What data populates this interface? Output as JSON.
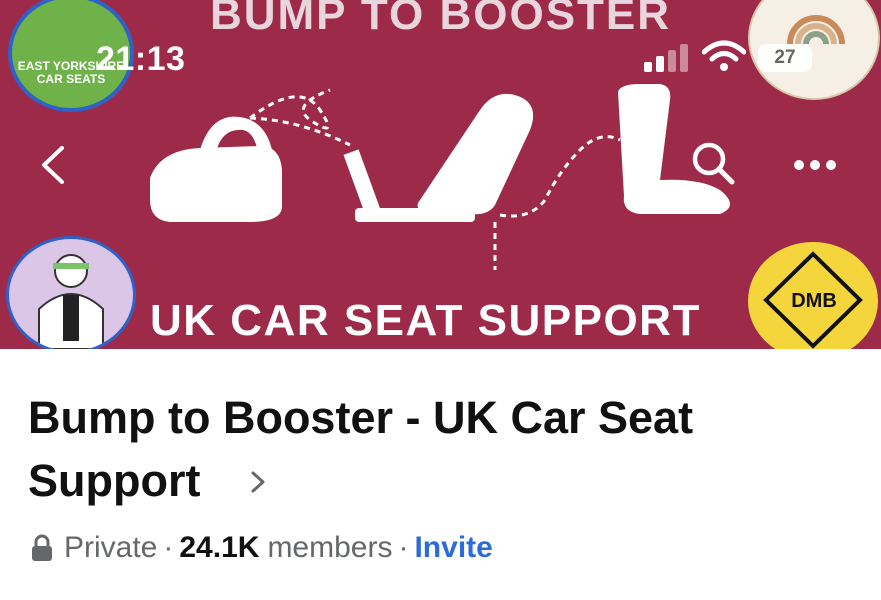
{
  "status_bar": {
    "time": "21:13",
    "battery_level": "27"
  },
  "cover": {
    "title": "BUMP TO BOOSTER",
    "subtitle": "UK CAR SEAT SUPPORT",
    "background_color": "#9e2a4a",
    "logos": {
      "top_left": "EAST YORKSHIRE CAR SEATS",
      "bottom_right": "DMB"
    }
  },
  "nav": {
    "back_icon": "chevron-left-icon",
    "search_icon": "search-icon",
    "more_icon": "more-horizontal-icon"
  },
  "group": {
    "name": "Bump to Booster - UK Car Seat Support",
    "privacy": "Private",
    "separator": "·",
    "member_count": "24.1K",
    "members_label": "members",
    "invite_label": "Invite",
    "link_color": "#2d6bd6"
  }
}
